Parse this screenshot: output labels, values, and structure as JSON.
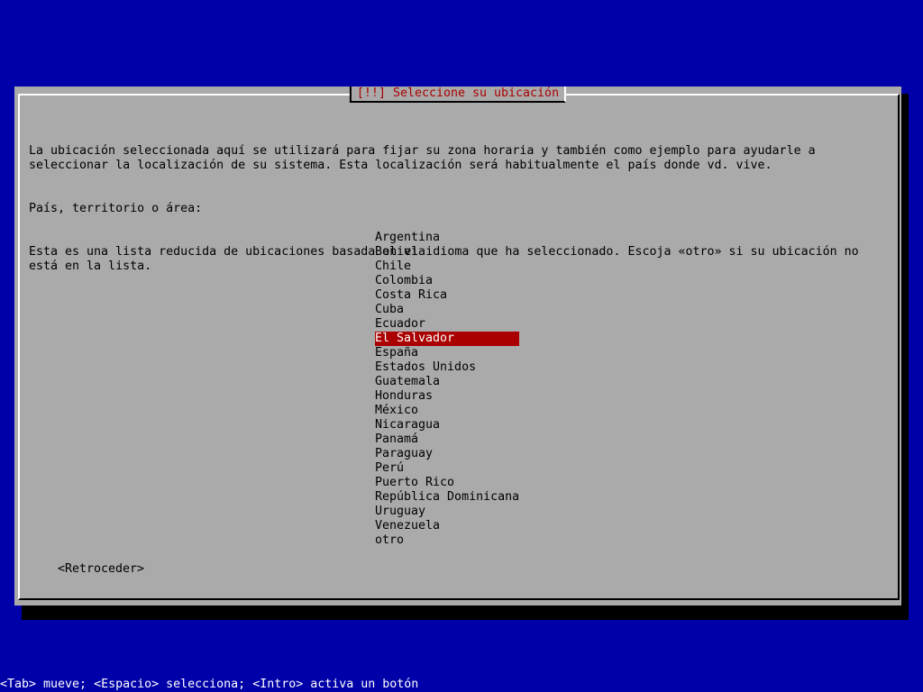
{
  "colors": {
    "desktop_background": "#0000a8",
    "dialog_background": "#aaaaaa",
    "title_text": "#aa0000",
    "selection_background": "#aa0000",
    "selection_text": "#ffffff",
    "statusbar_text": "#ffffff"
  },
  "dialog": {
    "title": "[!!] Seleccione su ubicación",
    "paragraphs": [
      "La ubicación seleccionada aquí se utilizará para fijar su zona horaria y también como ejemplo para ayudarle a\nseleccionar la localización de su sistema. Esta localización será habitualmente el país donde vd. vive.",
      "Esta es una lista reducida de ubicaciones basada en el idioma que ha seleccionado. Escoja «otro» si su ubicación no\nestá en la lista."
    ],
    "prompt": "País, territorio o área:",
    "countries": [
      "Argentina",
      "Bolivia",
      "Chile",
      "Colombia",
      "Costa Rica",
      "Cuba",
      "Ecuador",
      "El Salvador",
      "España",
      "Estados Unidos",
      "Guatemala",
      "Honduras",
      "México",
      "Nicaragua",
      "Panamá",
      "Paraguay",
      "Perú",
      "Puerto Rico",
      "República Dominicana",
      "Uruguay",
      "Venezuela",
      "otro"
    ],
    "selected_country": "El Salvador",
    "back_button": "<Retroceder>"
  },
  "statusbar": {
    "help_text": "<Tab> mueve; <Espacio> selecciona; <Intro> activa un botón"
  }
}
